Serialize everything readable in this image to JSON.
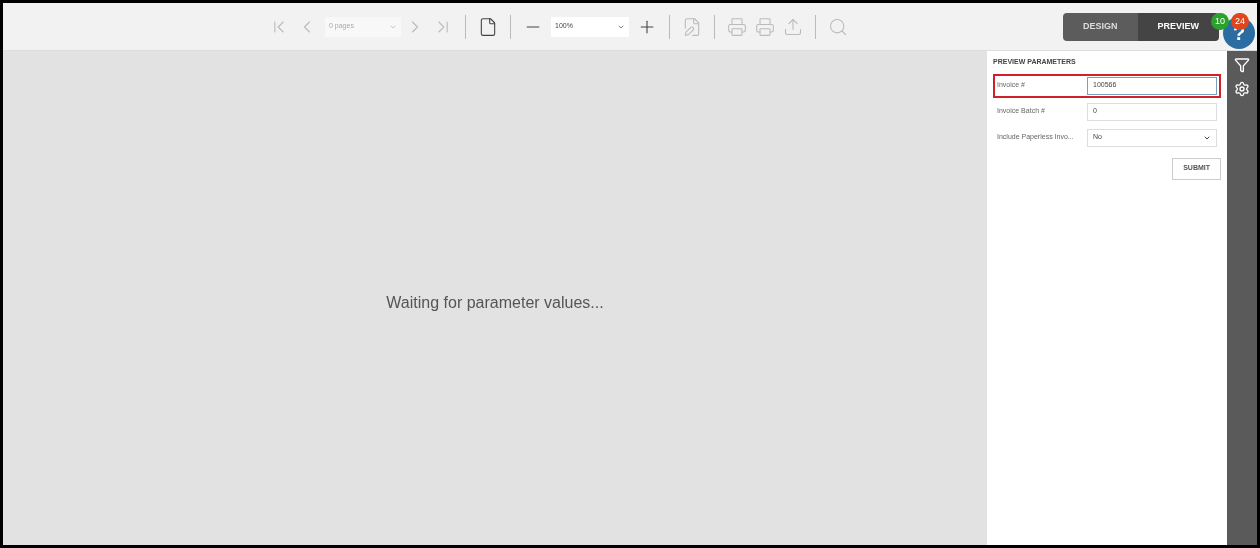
{
  "toolbar": {
    "page_select": "0 pages",
    "zoom_select": "100%"
  },
  "mode_tabs": [
    {
      "label": "DESIGN",
      "selected": false
    },
    {
      "label": "PREVIEW",
      "selected": true
    }
  ],
  "help": "?",
  "badges": [
    {
      "count": "10",
      "color": "#2ca02c"
    },
    {
      "count": "24",
      "color": "#e0461e"
    }
  ],
  "viewer": {
    "message": "Waiting for parameter values..."
  },
  "parameters": {
    "title": "PREVIEW PARAMETERS",
    "fields": [
      {
        "kind": "text",
        "label": "Invoice #",
        "value": "100566",
        "highlighted": true
      },
      {
        "kind": "text",
        "label": "Invoice Batch #",
        "value": "0",
        "highlighted": false
      },
      {
        "kind": "select",
        "label": "Include Paperless Invo...",
        "value": "No",
        "highlighted": false
      }
    ],
    "submit": "SUBMIT"
  }
}
